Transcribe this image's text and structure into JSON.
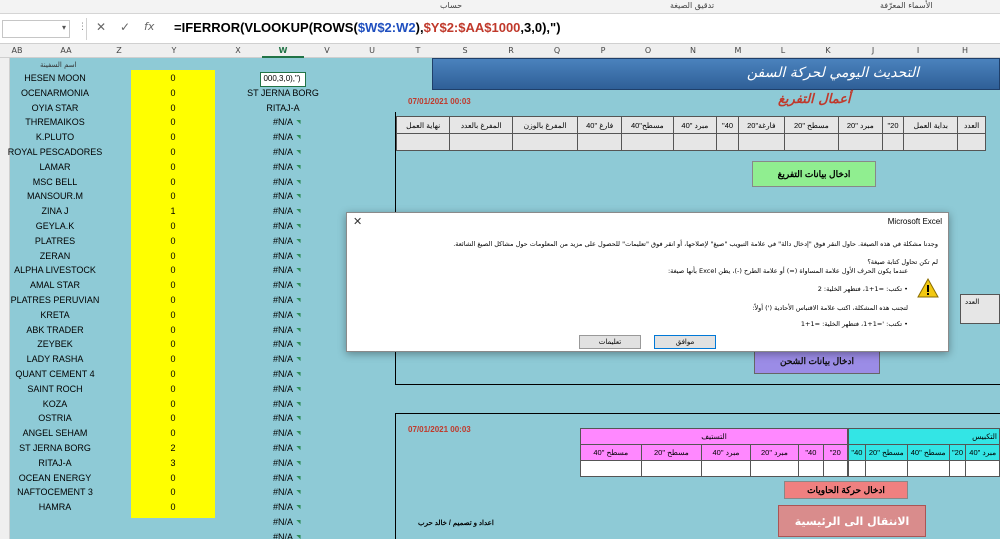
{
  "ribbon_labels": [
    "الأسماء المعرّفة",
    "تدقيق الصيغة",
    "حساب"
  ],
  "formula_bar": {
    "cancel_glyph": "✕",
    "enter_glyph": "✓",
    "fx_glyph": "fx",
    "formula_parts": [
      "=IFERROR(VLOOKUP(ROWS(",
      "$W$2:W2",
      "),",
      "$Y$2:$AA$1000",
      ",3,0),\")"
    ]
  },
  "columns": [
    "AB",
    "AA",
    "Z",
    "Y",
    "X",
    "W",
    "V",
    "U",
    "T",
    "S",
    "R",
    "Q",
    "P",
    "O",
    "N",
    "M",
    "L",
    "K",
    "J",
    "I",
    "H"
  ],
  "active_column": "W",
  "list": {
    "header_label": "اسم السفينة",
    "selected_cell_value": "000,3,0),\")",
    "rows": [
      {
        "name": "HESEN MOON",
        "value": "0",
        "w": ""
      },
      {
        "name": "OCENARMONIA",
        "value": "0",
        "w": "ST JERNA BORG"
      },
      {
        "name": "OYIA STAR",
        "value": "0",
        "w": "RITAJ-A"
      },
      {
        "name": "THREMAIKOS",
        "value": "0",
        "w": "#N/A"
      },
      {
        "name": "K.PLUTO",
        "value": "0",
        "w": "#N/A"
      },
      {
        "name": "ROYAL PESCADORES",
        "value": "0",
        "w": "#N/A"
      },
      {
        "name": "LAMAR",
        "value": "0",
        "w": "#N/A"
      },
      {
        "name": "MSC BELL",
        "value": "0",
        "w": "#N/A"
      },
      {
        "name": "MANSOUR.M",
        "value": "0",
        "w": "#N/A"
      },
      {
        "name": "ZINA J",
        "value": "1",
        "w": "#N/A"
      },
      {
        "name": "GEYLA.K",
        "value": "0",
        "w": "#N/A"
      },
      {
        "name": "PLATRES",
        "value": "0",
        "w": "#N/A"
      },
      {
        "name": "ZERAN",
        "value": "0",
        "w": "#N/A"
      },
      {
        "name": "ALPHA LIVESTOCK",
        "value": "0",
        "w": "#N/A"
      },
      {
        "name": "AMAL STAR",
        "value": "0",
        "w": "#N/A"
      },
      {
        "name": "PLATRES PERUVIAN",
        "value": "0",
        "w": "#N/A"
      },
      {
        "name": "KRETA",
        "value": "0",
        "w": "#N/A"
      },
      {
        "name": "ABK TRADER",
        "value": "0",
        "w": "#N/A"
      },
      {
        "name": "ZEYBEK",
        "value": "0",
        "w": "#N/A"
      },
      {
        "name": "LADY RASHA",
        "value": "0",
        "w": "#N/A"
      },
      {
        "name": "QUANT CEMENT 4",
        "value": "0",
        "w": "#N/A"
      },
      {
        "name": "SAINT ROCH",
        "value": "0",
        "w": "#N/A"
      },
      {
        "name": "KOZA",
        "value": "0",
        "w": "#N/A"
      },
      {
        "name": "OSTRIA",
        "value": "0",
        "w": "#N/A"
      },
      {
        "name": "ANGEL SEHAM",
        "value": "0",
        "w": "#N/A"
      },
      {
        "name": "ST JERNA BORG",
        "value": "2",
        "w": "#N/A"
      },
      {
        "name": "RITAJ-A",
        "value": "3",
        "w": "#N/A"
      },
      {
        "name": "OCEAN ENERGY",
        "value": "0",
        "w": "#N/A"
      },
      {
        "name": "NAFTOCEMENT 3",
        "value": "0",
        "w": "#N/A"
      },
      {
        "name": "HAMRA",
        "value": "0",
        "w": "#N/A"
      },
      {
        "name": "",
        "value": "",
        "w": "#N/A"
      },
      {
        "name": "",
        "value": "",
        "w": "#N/A"
      }
    ]
  },
  "dashboard": {
    "banner_title": "التحديث اليومي لحركة السفن",
    "unloading_title": "أعمال التفريغ",
    "date_top": "07/01/2021 00:03",
    "date_bottom": "07/01/2021 00:03",
    "unloading_headers": [
      "نهاية العمل",
      "المفرغ بالعدد",
      "المفرغ بالوزن",
      "فارغ \"40",
      "مسطح\"40",
      "مبرد \"40",
      "\"40",
      "فارغة\"20",
      "مسطح \"20",
      "مبرد \"20",
      "\"20",
      "بداية العمل",
      "العدد"
    ],
    "btn_unloading": "ادخال بيانات التفريغ",
    "btn_loading": "ادخال بيانات الشحن",
    "btn_containers": "ادخال حركة الحاويات",
    "btn_home": "الانتقال الى الرئيسية",
    "right_fragment_label": "العدد",
    "stuffing_label": "التستيف",
    "stuffing_headers": [
      "مسطح \"40",
      "مسطح \"20",
      "مبرد \"40",
      "مبرد \"20",
      "\"40",
      "\"20"
    ],
    "unstuffing_label": "التكبيس",
    "unstuffing_headers": [
      "\"40",
      "مسطح \"20",
      "مسطح \"40",
      "\"20",
      "مبرد \"40"
    ],
    "credit": "اعداد و تصميم / خالد حرب"
  },
  "dialog": {
    "title": "Microsoft Excel",
    "close_glyph": "✕",
    "lines": [
      "وجدنا مشكلة في هذه الصيغة. حاول النقر فوق \"إدخال دالة\" في علامة التبويب \"صيغ\" لإصلاحها، أو انقر فوق \"تعليمات\" للحصول على مزيد من المعلومات حول مشاكل الصيغ الشائعة.",
      "لم تكن تحاول كتابة صيغة؟",
      "عندما يكون الحرف الأول علامة المساواة (=) أو علامة الطرح (-)، يظن Excel بأنها صيغة:",
      "• تكتب: =1+1، فتظهر الخلية: 2",
      "لتجنب هذه المشكلة، اكتب علامة الاقتباس الأحادية (') أولاً:",
      "• تكتب: '=1+1، فتظهر الخلية: =1+1"
    ],
    "ok_label": "موافق",
    "help_label": "تعليمات"
  }
}
